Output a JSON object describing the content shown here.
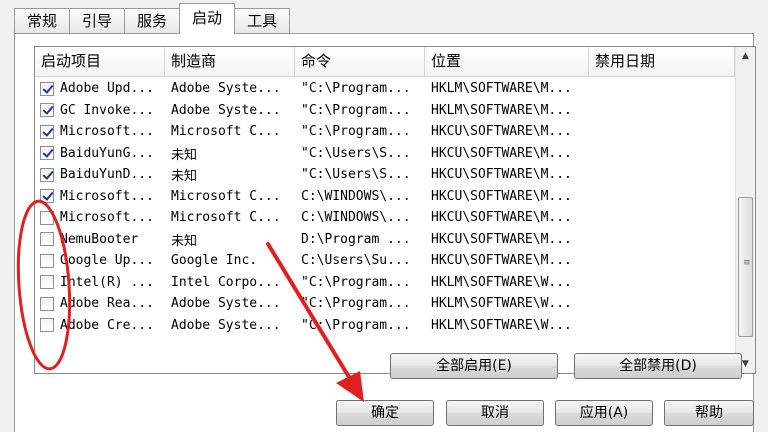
{
  "tabs": [
    {
      "label": "常规"
    },
    {
      "label": "引导"
    },
    {
      "label": "服务"
    },
    {
      "label": "启动"
    },
    {
      "label": "工具"
    }
  ],
  "list": {
    "headers": [
      "启动项目",
      "制造商",
      "命令",
      "位置",
      "禁用日期"
    ],
    "rows": [
      {
        "checked": true,
        "item": "Adobe Upd...",
        "maker": "Adobe Syste...",
        "command": "\"C:\\Program...",
        "location": "HKLM\\SOFTWARE\\M...",
        "date": ""
      },
      {
        "checked": true,
        "item": "GC Invoke...",
        "maker": "Adobe Syste...",
        "command": "\"C:\\Program...",
        "location": "HKLM\\SOFTWARE\\M...",
        "date": ""
      },
      {
        "checked": true,
        "item": "Microsoft...",
        "maker": "Microsoft C...",
        "command": "\"C:\\Program...",
        "location": "HKCU\\SOFTWARE\\M...",
        "date": ""
      },
      {
        "checked": true,
        "item": "BaiduYunG...",
        "maker": "未知",
        "command": "\"C:\\Users\\S...",
        "location": "HKCU\\SOFTWARE\\M...",
        "date": ""
      },
      {
        "checked": true,
        "item": "BaiduYunD...",
        "maker": "未知",
        "command": "\"C:\\Users\\S...",
        "location": "HKCU\\SOFTWARE\\M...",
        "date": ""
      },
      {
        "checked": true,
        "item": "Microsoft...",
        "maker": "Microsoft C...",
        "command": "C:\\WINDOWS\\...",
        "location": "HKCU\\SOFTWARE\\M...",
        "date": ""
      },
      {
        "checked": false,
        "item": "Microsoft...",
        "maker": "Microsoft C...",
        "command": "C:\\WINDOWS\\...",
        "location": "HKCU\\SOFTWARE\\M...",
        "date": ""
      },
      {
        "checked": false,
        "item": "NemuBooter",
        "maker": "未知",
        "command": "D:\\Program ...",
        "location": "HKCU\\SOFTWARE\\M...",
        "date": ""
      },
      {
        "checked": false,
        "item": "Google Up...",
        "maker": "Google Inc.",
        "command": "C:\\Users\\Su...",
        "location": "HKCU\\SOFTWARE\\M...",
        "date": ""
      },
      {
        "checked": false,
        "item": "Intel(R) ...",
        "maker": "Intel Corpo...",
        "command": "\"C:\\Program...",
        "location": "HKLM\\SOFTWARE\\W...",
        "date": ""
      },
      {
        "checked": false,
        "item": "Adobe Rea...",
        "maker": "Adobe Syste...",
        "command": "\"C:\\Program...",
        "location": "HKLM\\SOFTWARE\\W...",
        "date": ""
      },
      {
        "checked": false,
        "item": "Adobe Cre...",
        "maker": "Adobe Syste...",
        "command": "\"C:\\Program...",
        "location": "HKLM\\SOFTWARE\\W...",
        "date": ""
      }
    ]
  },
  "buttons": {
    "enable_all": "全部启用(E)",
    "disable_all": "全部禁用(D)",
    "ok": "确定",
    "cancel": "取消",
    "apply": "应用(A)",
    "help": "帮助"
  },
  "icons": {
    "scroll_up": "scroll-up-arrow-icon",
    "scroll_down": "scroll-down-arrow-icon",
    "grip": "scroll-grip-icon"
  },
  "colors": {
    "annotation": "#e02020",
    "checkmark": "#1e3a8a"
  }
}
